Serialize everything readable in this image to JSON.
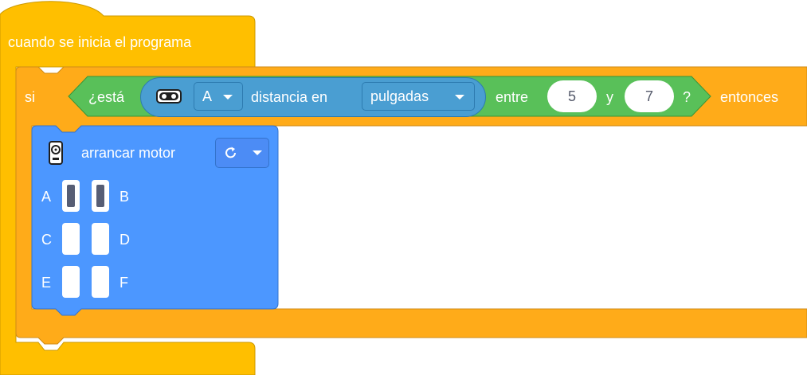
{
  "hat_block": {
    "label": "cuando se inicia el programa"
  },
  "if_block": {
    "label_if": "si",
    "label_then": "entonces"
  },
  "condition": {
    "label_is": "¿está",
    "sensor_port": "A",
    "label_distance": "distancia en",
    "unit": "pulgadas",
    "label_between": "entre",
    "min_value": "5",
    "label_and": "y",
    "max_value": "7",
    "question_mark": "?"
  },
  "motor_block": {
    "label": "arrancar motor",
    "direction_icon": "clockwise-arrow-icon",
    "ports": [
      {
        "name": "A",
        "selected": true
      },
      {
        "name": "B",
        "selected": true
      },
      {
        "name": "C",
        "selected": false
      },
      {
        "name": "D",
        "selected": false
      },
      {
        "name": "E",
        "selected": false
      },
      {
        "name": "F",
        "selected": false
      }
    ]
  },
  "colors": {
    "events": "#ffbf00",
    "control": "#ffab19",
    "operators": "#59c059",
    "sensors": "#5cb1d6",
    "motors": "#4c97ff"
  }
}
